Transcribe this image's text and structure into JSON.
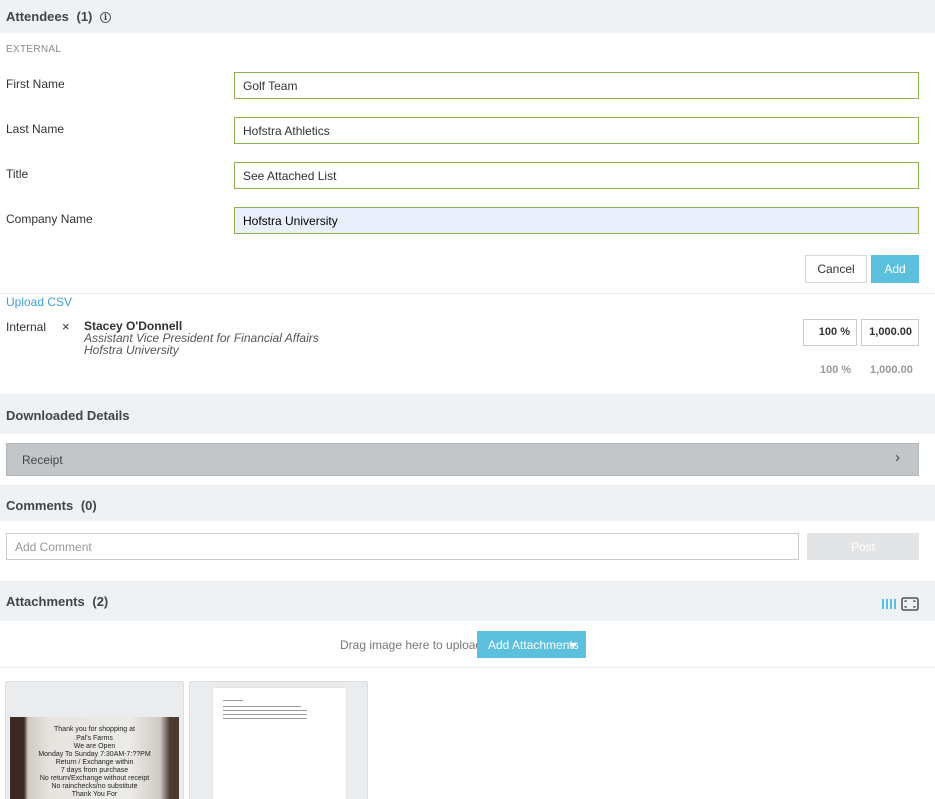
{
  "attendees": {
    "title": "Attendees",
    "count": "(1)",
    "type_label": "EXTERNAL",
    "fields": [
      {
        "label": "First Name",
        "value": "Golf Team"
      },
      {
        "label": "Last Name",
        "value": "Hofstra Athletics"
      },
      {
        "label": "Title",
        "value": "See Attached List"
      },
      {
        "label": "Company Name",
        "value": "Hofstra University"
      }
    ],
    "cancel_label": "Cancel",
    "add_label": "Add",
    "upload_csv": "Upload CSV",
    "internal": {
      "label": "Internal",
      "remove_glyph": "×",
      "name": "Stacey O'Donnell",
      "role": "Assistant Vice President for Financial Affairs",
      "org": "Hofstra University",
      "percent": "100 %",
      "amount": "1,000.00"
    },
    "totals": {
      "percent": "100 %",
      "amount": "1,000.00"
    }
  },
  "downloaded_details": {
    "title": "Downloaded Details",
    "item_label": "Receipt",
    "chevron": "›"
  },
  "comments": {
    "title": "Comments",
    "count": "(0)",
    "placeholder": "Add Comment",
    "post_label": "Post"
  },
  "attachments": {
    "title": "Attachments",
    "count": "(2)",
    "drag_text": "Drag image here to upload",
    "add_label": "Add Attachments",
    "receipt_lines": [
      "Thank you for shopping at",
      "Pal's Farms",
      "We are Open",
      "Monday To Sunday 7:30AM-7:??PM",
      "Return / Exchange within",
      "7 days from purchase",
      "No return/Exchange without receipt",
      "No rainchecks/no substitute",
      "Thank You For"
    ]
  },
  "colors": {
    "accent": "#5bc0de",
    "link": "#3ea1d6",
    "field_border": "#8fb04e",
    "section_band": "#eef2f5",
    "receipt_bar": "#c3c6c8"
  },
  "icons": [
    "info-icon",
    "close-icon",
    "chevron-right-icon",
    "grid-view-icon",
    "fullscreen-icon",
    "caret-down-icon"
  ]
}
